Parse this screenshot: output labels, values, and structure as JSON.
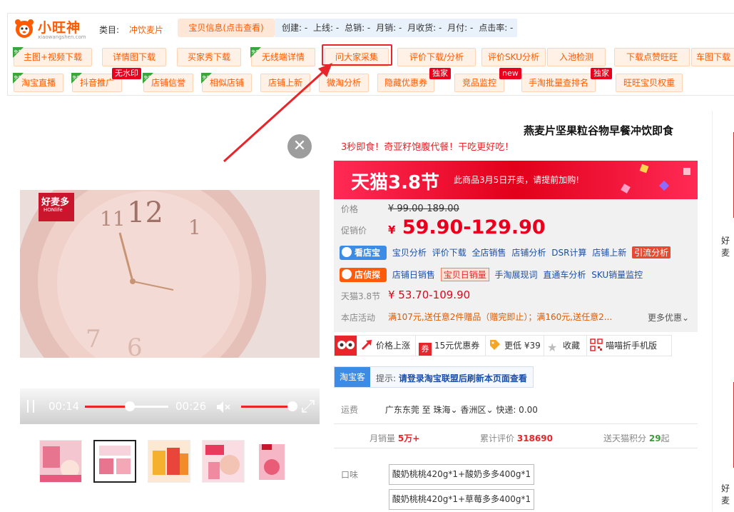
{
  "plugin": {
    "logo_name": "小旺神",
    "logo_url": "xiaowangshen.com",
    "category_label": "类目:",
    "category_value": "冲饮麦片",
    "info_button": "宝贝信息(点击查看)",
    "stats": [
      "创建: -",
      "上线: -",
      "总销: -",
      "月销: -",
      "月收货: -",
      "月付: -",
      "点击率: -"
    ],
    "row2": [
      "主图+视频下载",
      "详情图下载",
      "买家秀下载",
      "无线端详情",
      "问大家采集",
      "评价下载/分析",
      "评价SKU分析",
      "入池检测",
      "下载点赞旺旺",
      "车图下载"
    ],
    "row3": [
      "淘宝直播",
      "抖音推广",
      "店铺信誉",
      "相似店铺",
      "店铺上新",
      "微淘分析",
      "隐藏优惠券",
      "竞品监控",
      "手淘批量查排名",
      "旺旺宝贝权重"
    ],
    "free_badge": "免费",
    "tags": {
      "no_watermark": "无水印",
      "exclusive": "独家",
      "new": "new"
    }
  },
  "media": {
    "close_symbol": "✕",
    "video_brand": "好麦多",
    "video_brand_sub": "HONlife",
    "current_time": "00:14",
    "total_time": "00:26",
    "progress": 0.54,
    "volume": 1.0,
    "thumbnail_count": 5,
    "active_thumbnail": 1
  },
  "product": {
    "title": "燕麦片坚果粒谷物早餐冲饮即食",
    "subtitle": "3秒即食！奇亚籽饱腹代餐！干吃更好吃！",
    "banner_logo": "天猫3.8节",
    "banner_text": "此商品3月5日开卖，请提前加购!",
    "price_label": "价格",
    "original_price": "¥ 99.00-189.00",
    "promo_label": "促销价",
    "promo_currency": "¥",
    "promo_price": "59.90-129.90",
    "kandianbao": "看店宝",
    "kandianbao_links": [
      "宝贝分析",
      "评价下载",
      "全店销售",
      "店铺分析",
      "DSR计算",
      "店铺上新"
    ],
    "kandianbao_highlight": "引流分析",
    "diantan": "店侦探",
    "diantan_links_a": [
      "店铺日销售"
    ],
    "diantan_highlight": "宝贝日销量",
    "diantan_links_b": [
      "手淘展现词",
      "直通车分析",
      "SKU销量监控"
    ],
    "festival_label": "天猫3.8节",
    "festival_price": "¥ 53.70-109.90",
    "activity_label": "本店活动",
    "activity_text": "满107元,送任意2件赠品（赠完即止）；满160元,送任意2...",
    "more_offers": "更多优惠"
  },
  "actions": [
    "价格上涨",
    "15元优惠券",
    "更低 ¥39",
    "收藏",
    "喵喵折手机版"
  ],
  "taoke": {
    "tag": "淘宝客",
    "tip_prefix": "提示: ",
    "tip_bold": "请登录淘宝联盟后刷新本页面查看"
  },
  "shipping": {
    "label": "运费",
    "from": "广东东莞",
    "to_word": "至",
    "to": "珠海",
    "district": "香洲区",
    "express": "快递: 0.00"
  },
  "metrics": {
    "monthly_label": "月销量",
    "monthly_value": "5万+",
    "reviews_label": "累计评价",
    "reviews_value": "318690",
    "points_label": "送天猫积分",
    "points_value": "29",
    "points_suffix": "起"
  },
  "sku": {
    "label": "口味",
    "options": [
      "酸奶桃桃420g*1+酸奶多多400g*1",
      "酸奶桃桃420g*1+草莓多多400g*1"
    ]
  },
  "right_edge": [
    "好麦",
    "好麦"
  ],
  "colors": {
    "accent": "#ff5a00",
    "price_red": "#e8001c",
    "link_blue": "#1a4fa8",
    "free_green": "#3aa53a"
  }
}
